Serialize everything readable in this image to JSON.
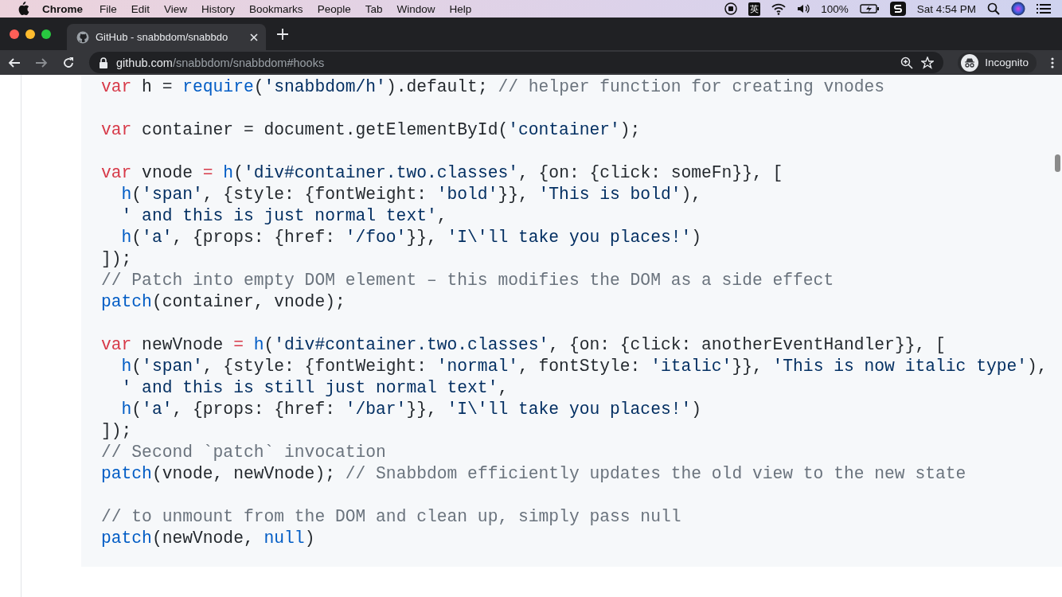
{
  "menubar": {
    "app": "Chrome",
    "items": [
      "File",
      "Edit",
      "View",
      "History",
      "Bookmarks",
      "People",
      "Tab",
      "Window",
      "Help"
    ],
    "input_method": "英",
    "battery": "100%",
    "clock": "Sat 4:54 PM"
  },
  "tabs": [
    {
      "title": "GitHub - snabbdom/snabbdo",
      "selected": true
    }
  ],
  "address_bar": {
    "host": "github.com",
    "path": "/snabbdom/snabbdom#hooks"
  },
  "profile": {
    "label": "Incognito"
  },
  "code": [
    {
      "lines": [
        {
          "tokens": [
            {
              "kind": "kw",
              "t": "var"
            },
            {
              "kind": "p",
              "t": " h = "
            },
            {
              "kind": "fn",
              "t": "require"
            },
            {
              "kind": "p",
              "t": "("
            },
            {
              "kind": "str",
              "t": "'snabbdom/h'"
            },
            {
              "kind": "p",
              "t": ").default; "
            },
            {
              "kind": "cm",
              "t": "// helper function for creating vnodes"
            }
          ]
        }
      ]
    },
    {
      "lines": [
        {
          "tokens": [
            {
              "kind": "kw",
              "t": "var"
            },
            {
              "kind": "p",
              "t": " container = document.getElementById("
            },
            {
              "kind": "str",
              "t": "'container'"
            },
            {
              "kind": "p",
              "t": ");"
            }
          ]
        }
      ]
    },
    {
      "lines": [
        {
          "tokens": [
            {
              "kind": "kw",
              "t": "var"
            },
            {
              "kind": "p",
              "t": " vnode "
            },
            {
              "kind": "kw",
              "t": "="
            },
            {
              "kind": "fn",
              "t": " h"
            },
            {
              "kind": "p",
              "t": "("
            },
            {
              "kind": "str",
              "t": "'div#container.two.classes'"
            },
            {
              "kind": "p",
              "t": ", {on: {click: someFn}}, ["
            }
          ]
        },
        {
          "indented": true,
          "tokens": [
            {
              "kind": "fn",
              "t": "h"
            },
            {
              "kind": "p",
              "t": "("
            },
            {
              "kind": "str",
              "t": "'span'"
            },
            {
              "kind": "p",
              "t": ", {style: {fontWeight: "
            },
            {
              "kind": "str",
              "t": "'bold'"
            },
            {
              "kind": "p",
              "t": "}}, "
            },
            {
              "kind": "str",
              "t": "'This is bold'"
            },
            {
              "kind": "p",
              "t": "),"
            }
          ]
        },
        {
          "indented": true,
          "tokens": [
            {
              "kind": "str",
              "t": "' and this is just normal text'"
            },
            {
              "kind": "p",
              "t": ","
            }
          ]
        },
        {
          "indented": true,
          "tokens": [
            {
              "kind": "fn",
              "t": "h"
            },
            {
              "kind": "p",
              "t": "("
            },
            {
              "kind": "str",
              "t": "'a'"
            },
            {
              "kind": "p",
              "t": ", {props: {href: "
            },
            {
              "kind": "str",
              "t": "'/foo'"
            },
            {
              "kind": "p",
              "t": "}}, "
            },
            {
              "kind": "str",
              "t": "'I\\'ll take you places!'"
            },
            {
              "kind": "p",
              "t": ")"
            }
          ]
        },
        {
          "tokens": [
            {
              "kind": "p",
              "t": "]);"
            }
          ]
        },
        {
          "tokens": [
            {
              "kind": "cm",
              "t": "// Patch into empty DOM element – this modifies the DOM as a side effect"
            }
          ]
        },
        {
          "tokens": [
            {
              "kind": "fn",
              "t": "patch"
            },
            {
              "kind": "p",
              "t": "(container, vnode);"
            }
          ]
        }
      ]
    },
    {
      "lines": [
        {
          "tokens": [
            {
              "kind": "kw",
              "t": "var"
            },
            {
              "kind": "p",
              "t": " newVnode "
            },
            {
              "kind": "kw",
              "t": "="
            },
            {
              "kind": "fn",
              "t": " h"
            },
            {
              "kind": "p",
              "t": "("
            },
            {
              "kind": "str",
              "t": "'div#container.two.classes'"
            },
            {
              "kind": "p",
              "t": ", {on: {click: anotherEventHandler}}, ["
            }
          ]
        },
        {
          "indented": true,
          "tokens": [
            {
              "kind": "fn",
              "t": "h"
            },
            {
              "kind": "p",
              "t": "("
            },
            {
              "kind": "str",
              "t": "'span'"
            },
            {
              "kind": "p",
              "t": ", {style: {fontWeight: "
            },
            {
              "kind": "str",
              "t": "'normal'"
            },
            {
              "kind": "p",
              "t": ", fontStyle: "
            },
            {
              "kind": "str",
              "t": "'italic'"
            },
            {
              "kind": "p",
              "t": "}}, "
            },
            {
              "kind": "str",
              "t": "'This is now italic type'"
            },
            {
              "kind": "p",
              "t": "),"
            }
          ]
        },
        {
          "indented": true,
          "tokens": [
            {
              "kind": "str",
              "t": "' and this is still just normal text'"
            },
            {
              "kind": "p",
              "t": ","
            }
          ]
        },
        {
          "indented": true,
          "tokens": [
            {
              "kind": "fn",
              "t": "h"
            },
            {
              "kind": "p",
              "t": "("
            },
            {
              "kind": "str",
              "t": "'a'"
            },
            {
              "kind": "p",
              "t": ", {props: {href: "
            },
            {
              "kind": "str",
              "t": "'/bar'"
            },
            {
              "kind": "p",
              "t": "}}, "
            },
            {
              "kind": "str",
              "t": "'I\\'ll take you places!'"
            },
            {
              "kind": "p",
              "t": ")"
            }
          ]
        },
        {
          "tokens": [
            {
              "kind": "p",
              "t": "]);"
            }
          ]
        },
        {
          "tokens": [
            {
              "kind": "cm",
              "t": "// Second `patch` invocation"
            }
          ]
        },
        {
          "tokens": [
            {
              "kind": "fn",
              "t": "patch"
            },
            {
              "kind": "p",
              "t": "(vnode, newVnode); "
            },
            {
              "kind": "cm",
              "t": "// Snabbdom efficiently updates the old view to the new state"
            }
          ]
        }
      ]
    },
    {
      "lines": [
        {
          "tokens": [
            {
              "kind": "cm",
              "t": "// to unmount from the DOM and clean up, simply pass null"
            }
          ]
        },
        {
          "tokens": [
            {
              "kind": "fn",
              "t": "patch"
            },
            {
              "kind": "p",
              "t": "(newVnode, "
            },
            {
              "kind": "fn",
              "t": "null"
            },
            {
              "kind": "p",
              "t": ")"
            }
          ]
        }
      ]
    }
  ]
}
